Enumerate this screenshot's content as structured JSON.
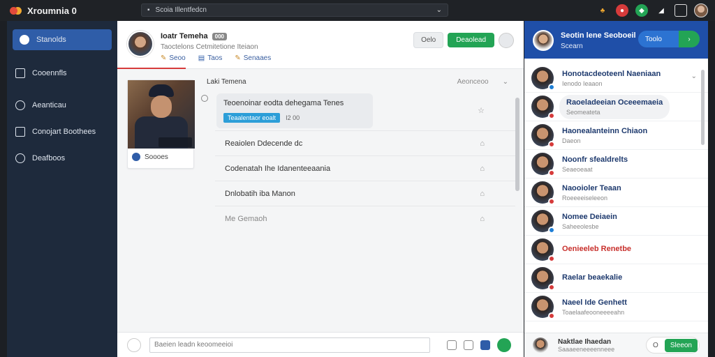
{
  "app": {
    "title": "Xroumnia 0"
  },
  "addressbar": {
    "text": "Scoia Illentfedcn"
  },
  "sidebar": {
    "items": [
      {
        "label": "Stanolds",
        "active": true
      },
      {
        "label": "Cooennfls"
      },
      {
        "label": "Aeanticau"
      },
      {
        "label": "Conojart Boothees"
      },
      {
        "label": "Deafboos"
      }
    ]
  },
  "profile": {
    "name": "Ioatr Temeha",
    "badge": "000",
    "subtitle": "Taoctelons Cetmitetione Iteiaon",
    "links": [
      "Seoo",
      "Taos",
      "Senaaes"
    ],
    "btn_gray": "Oelo",
    "btn_green": "Deaolead"
  },
  "card": {
    "label": "Soooes"
  },
  "list": {
    "title": "Laki Temena",
    "col": "Aeonceoo",
    "first": {
      "text": "Teoenoinar eodta  dehegama Tenes",
      "tag": "Teaalentaor eoalt",
      "count": "I2 00"
    },
    "rows": [
      "Reaiolen Ddecende dc",
      "Codenatah Ihe Idanenteeaania",
      "Dnlobatih iba Manon",
      "Me Gemaoh"
    ]
  },
  "compose": {
    "placeholder": "Baeien leadn keoomeeioi"
  },
  "rpanel": {
    "name": "Seotin lene Seoboeil",
    "sub": "Scearn",
    "pill": "Toolo",
    "contacts": [
      {
        "name": "Honotacdeoteenl Naeniaan",
        "msg": "Ienodo Ieaaon",
        "status": "#1e7fd6",
        "red": false
      },
      {
        "name": "Raoeladeeian Oceeemaeia",
        "msg": "Seomeateta",
        "status": "#d63b3b",
        "red": false,
        "pill": true
      },
      {
        "name": "Haonealanteinn Chiaon",
        "msg": "Daeon",
        "status": "#d63b3b",
        "red": false
      },
      {
        "name": "Noonfr sfealdrelts",
        "msg": "Seaeoeaat",
        "status": "#d63b3b",
        "red": false
      },
      {
        "name": "Naooioler Teaan",
        "msg": "Roeeeeiseleeon",
        "status": "#d63b3b",
        "red": false
      },
      {
        "name": "Nomee Deiaein",
        "msg": "Saheeolesbe",
        "status": "#1e7fd6",
        "red": false
      },
      {
        "name": "Oenieeleb Renetbe",
        "msg": "",
        "status": "#d63b3b",
        "red": true
      },
      {
        "name": "Raelar beaekalie",
        "msg": "",
        "status": "#d63b3b",
        "red": false
      },
      {
        "name": "Naeel Ide Genhett",
        "msg": "Toaelaafeooneeeeahn",
        "status": "#d63b3b",
        "red": false
      }
    ],
    "bottom": {
      "name": "Naktlae Ihaedan",
      "msg": "Saaaeeneeeenneee",
      "left": "O",
      "right": "Sleeon"
    }
  },
  "colors": {
    "accent": "#2f5da8",
    "green": "#23a455",
    "header": "#1f4fa8"
  }
}
